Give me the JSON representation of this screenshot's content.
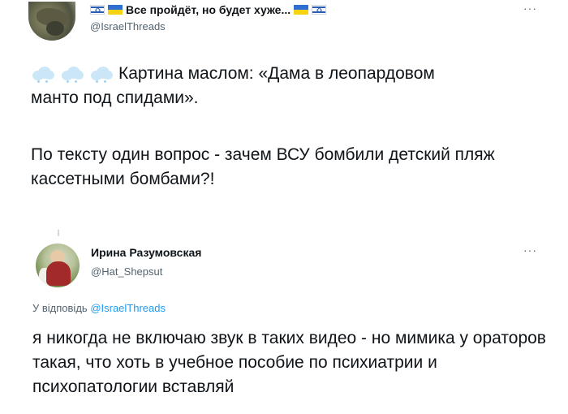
{
  "tweet1": {
    "display_name": "Все пройдёт, но будет хуже...",
    "handle": "@IsraelThreads",
    "text_line1": "Картина маслом: «Дама в леопардовом",
    "text_line2": "манто под спидами».",
    "text_paragraph2": "По тексту один вопрос - зачем ВСУ бомбили детский пляж кассетными бомбами?!",
    "emoji_icons": [
      "cloud-icon",
      "cloud-icon",
      "cloud-icon"
    ],
    "flag_icons": [
      "israel-flag-icon",
      "ukraine-flag-icon",
      "ukraine-flag-icon",
      "israel-flag-icon"
    ]
  },
  "tweet2": {
    "display_name": "Ирина Разумовская",
    "handle": "@Hat_Shepsut",
    "reply_prefix": "У відповідь",
    "reply_handle": "@IsraelThreads",
    "text": "я никогда не включаю звук в таких видео - но мимика у ораторов такая, что хоть в учебное пособие по психиатрии и психопатологии вставляй"
  },
  "more_icon": "···",
  "colors": {
    "link": "#1d9bf0",
    "secondary": "#536471",
    "text": "#0f1419"
  }
}
